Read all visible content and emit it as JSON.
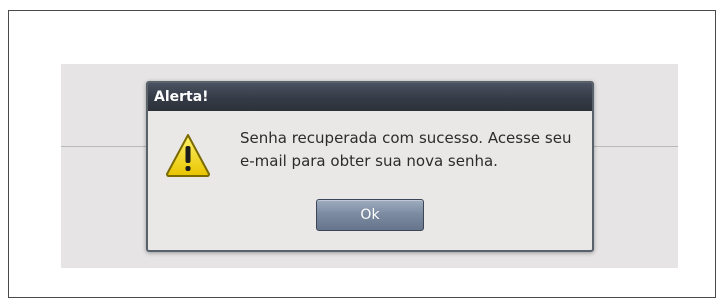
{
  "dialog": {
    "title": "Alerta!",
    "message": "Senha recuperada com sucesso. Acesse seu e-mail para obter sua nova senha.",
    "ok_label": "Ok",
    "icon": "warning-icon"
  },
  "colors": {
    "titlebar": "#353b46",
    "dialog_background": "#e9e8e7",
    "button": "#7d8ca2",
    "overlay": "#e6e4e4",
    "warning_yellow": "#f2d600"
  }
}
